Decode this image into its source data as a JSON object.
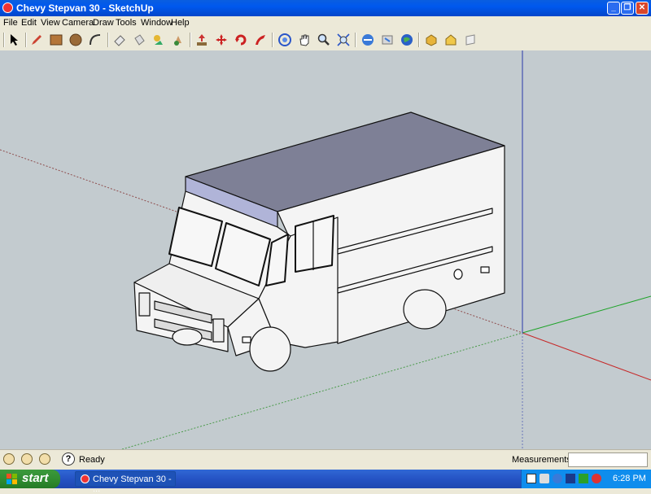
{
  "window": {
    "title": "Chevy Stepvan 30 - SketchUp"
  },
  "menu": [
    "File",
    "Edit",
    "View",
    "Camera",
    "Draw",
    "Tools",
    "Window",
    "Help"
  ],
  "toolbar_icons": [
    "select-icon",
    "pencil-icon",
    "rectangle-icon",
    "circle-icon",
    "arc-icon",
    "eraser-icon",
    "paint-bucket-icon",
    "tape-measure-icon",
    "paint-icon",
    "push-pull-icon",
    "move-icon",
    "rotate-icon",
    "follow-me-icon",
    "orbit-icon",
    "pan-icon",
    "zoom-icon",
    "zoom-extents-icon",
    "get-models-icon",
    "share-model-icon",
    "google-earth-icon",
    "components-icon",
    "3d-warehouse-icon",
    "section-icon"
  ],
  "status": {
    "text": "Ready",
    "measurements_label": "Measurements",
    "measurements_value": ""
  },
  "taskbar": {
    "start_label": "start",
    "task_item": "Chevy Stepvan 30 - ...",
    "clock": "6:28 PM"
  },
  "colors": {
    "viewport_bg": "#c3cbcf",
    "roof": "#7e8096",
    "roof_front": "#b0b4d8",
    "body": "#f4f4f4",
    "axis_red": "#c62828",
    "axis_green": "#1fa32a",
    "axis_blue": "#2a3aa8"
  }
}
